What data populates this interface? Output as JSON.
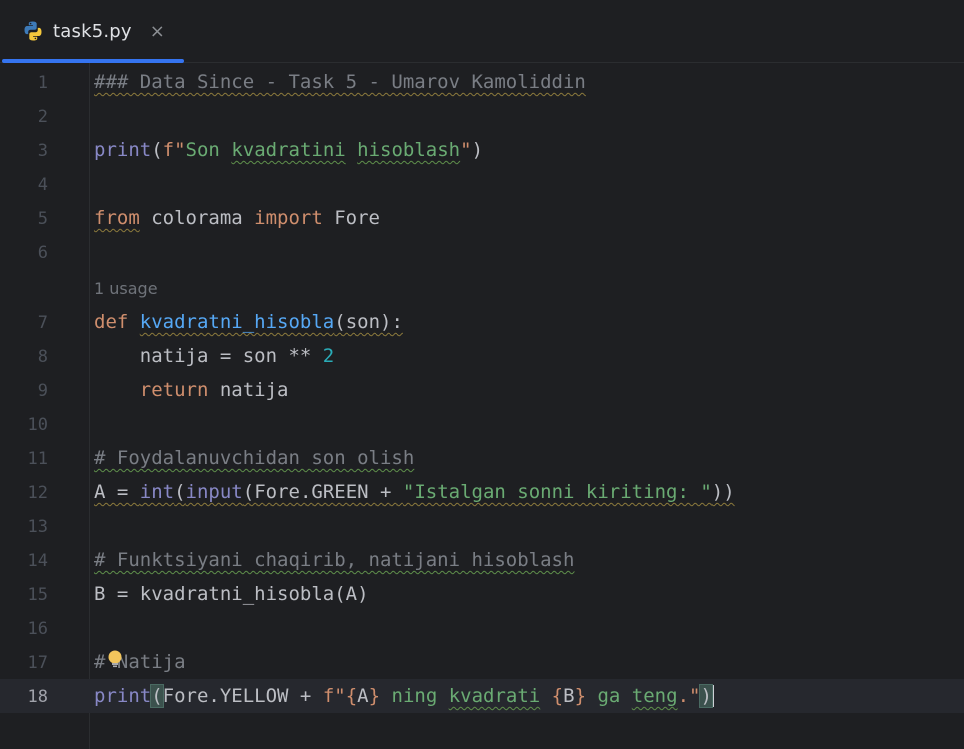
{
  "tab": {
    "filename": "task5.py",
    "close_glyph": "×",
    "icon": "python-file-icon"
  },
  "inlay_hint": "1 usage",
  "lines": [
    {
      "n": "1",
      "t1": "### Data Since - Task 5 - Umarov Kamoliddin"
    },
    {
      "n": "2"
    },
    {
      "n": "3",
      "fn": "print",
      "open": "(",
      "fpre": "f\"",
      "w1": "Son ",
      "w2": "kvadratini",
      "sp": " ",
      "w3": "hisoblash",
      "q": "\"",
      "close": ")"
    },
    {
      "n": "4"
    },
    {
      "n": "5",
      "kw1": "from",
      "mod": " colorama ",
      "kw2": "import",
      "name": " Fore"
    },
    {
      "n": "6"
    },
    {
      "n": "7",
      "kw": "def",
      "fname": "kvadratni_hisobla",
      "rest": "(son):"
    },
    {
      "n": "8",
      "indent": "    ",
      "a": "natija = son ** ",
      "num": "2"
    },
    {
      "n": "9",
      "indent": "    ",
      "kw": "return",
      "rest": " natija"
    },
    {
      "n": "10"
    },
    {
      "n": "11",
      "t1": "# Foydalanuvchidan son olish"
    },
    {
      "n": "12",
      "a": "A = ",
      "int": "int",
      "p1": "(",
      "inp": "input",
      "p2": "(Fore.GREEN + ",
      "str": "\"Istalgan sonni kiriting: \"",
      "p3": "))"
    },
    {
      "n": "13"
    },
    {
      "n": "14",
      "t1": "# Funktsiyani chaqirib, natijani hisoblash"
    },
    {
      "n": "15",
      "a": "B = kvadratni_hisobla(A)"
    },
    {
      "n": "16"
    },
    {
      "n": "17",
      "t1": "# ",
      "t2": "Natija"
    },
    {
      "n": "18",
      "fn": "print",
      "open": "(",
      "a": "Fore.YELLOW + ",
      "fpre": "f\"",
      "b1": "{",
      "v1": "A",
      "b2": "}",
      "s1": " ning ",
      "w1": "kvadrati",
      "s2": " ",
      "b3": "{",
      "v2": "B",
      "b4": "}",
      "s3": " ga ",
      "w2": "teng",
      "s4": ".\"",
      "close": ")"
    }
  ]
}
